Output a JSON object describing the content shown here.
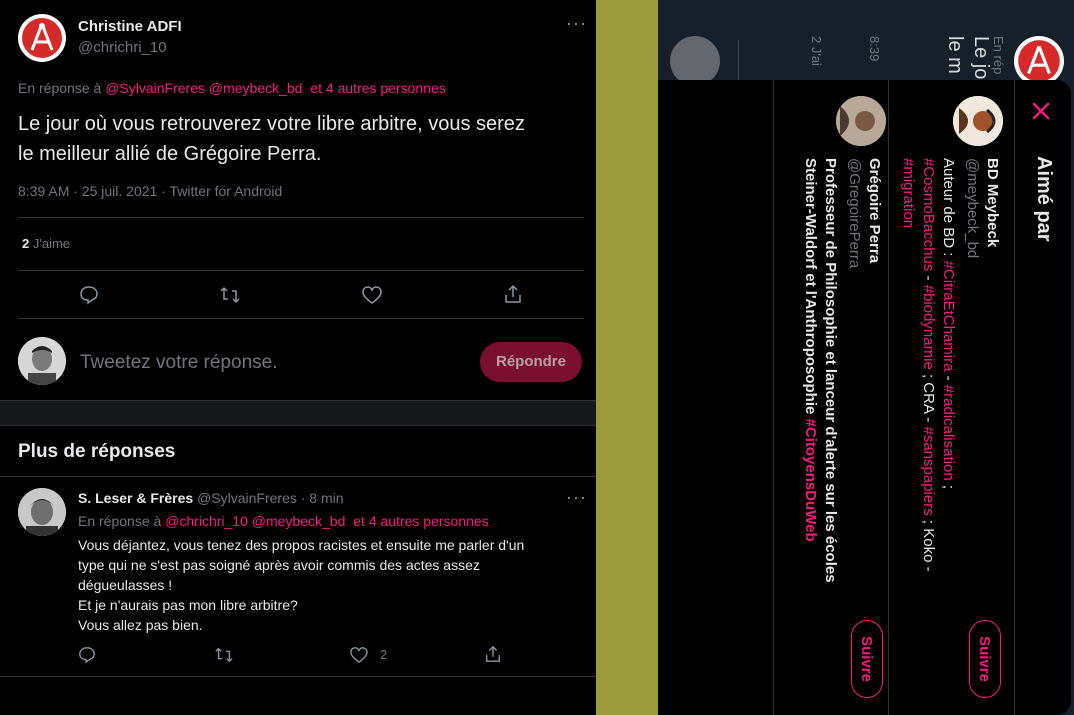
{
  "tweet": {
    "author_name": "Christine ADFI",
    "author_handle": "@chrichri_10",
    "reply_prefix": "En réponse à",
    "reply_mentions": "@SylvainFreres @meybeck_bd",
    "reply_others": "et 4 autres personnes",
    "text_line1": "Le jour où vous retrouverez votre libre arbitre, vous serez",
    "text_line2": "le meilleur allié de Grégoire Perra.",
    "meta": "8:39 AM · 25 juil. 2021 · Twitter for Android",
    "likes_count": "2",
    "likes_label": "J'aime"
  },
  "composer": {
    "placeholder": "Tweetez votre réponse.",
    "button": "Répondre"
  },
  "more_replies": {
    "heading": "Plus de réponses",
    "reply": {
      "author_name": "S. Leser & Frères",
      "author_handle": "@SylvainFreres",
      "time": "· 8 min",
      "reply_prefix": "En réponse à",
      "reply_mentions": "@chrichri_10 @meybeck_bd",
      "reply_others": "et 4 autres personnes",
      "lines": [
        "Vous déjantez, vous tenez des propos racistes et ensuite me parler d'un",
        "type qui ne s'est pas soigné après avoir commis des actes assez",
        "dégueulasses !",
        "Et je n'aurais pas mon libre arbitre?",
        "Vous allez pas bien."
      ],
      "like_count": "2"
    }
  },
  "background_fragments": {
    "reply_prefix": "En rép",
    "text": "Le jo",
    "text2": "le m",
    "time": "8:39",
    "likes": "2 J'ai"
  },
  "liked_by": {
    "title": "Aimé par",
    "users": [
      {
        "name": "BD Meybeck",
        "handle": "@meybeck_bd",
        "bio_parts": [
          {
            "t": "Auteur de BD : ",
            "c": "text"
          },
          {
            "t": "#CitraEtChamira",
            "c": "tag"
          },
          {
            "t": " - ",
            "c": "text"
          },
          {
            "t": "#radicalisation",
            "c": "tag"
          },
          {
            "t": " ; ",
            "c": "text"
          },
          {
            "t": "#CosmoBacchus",
            "c": "tag"
          },
          {
            "t": " - ",
            "c": "text"
          },
          {
            "t": "#biodynamie",
            "c": "tag"
          },
          {
            "t": " ; CRA - ",
            "c": "text"
          },
          {
            "t": "#sanspapiers",
            "c": "tag"
          },
          {
            "t": " ; Koko - ",
            "c": "text"
          },
          {
            "t": "#migration",
            "c": "tag"
          }
        ],
        "follow": "Suivre"
      },
      {
        "name": "Grégoire Perra",
        "handle": "@GregoirePerra",
        "bio_parts": [
          {
            "t": "Professeur de Philosophie et lanceur d'alerte sur les écoles Steiner-",
            "c": "text"
          },
          {
            "t": "Waldorf et l'Anthroposophie ",
            "c": "text"
          },
          {
            "t": "#CitoyensDuWeb",
            "c": "tag"
          }
        ],
        "follow": "Suivre"
      }
    ]
  },
  "colors": {
    "accent": "#f91880",
    "muted": "#71767b",
    "reply_button": "#7a1030",
    "olive": "#9a9a3c",
    "dim_bg": "#15202b"
  }
}
